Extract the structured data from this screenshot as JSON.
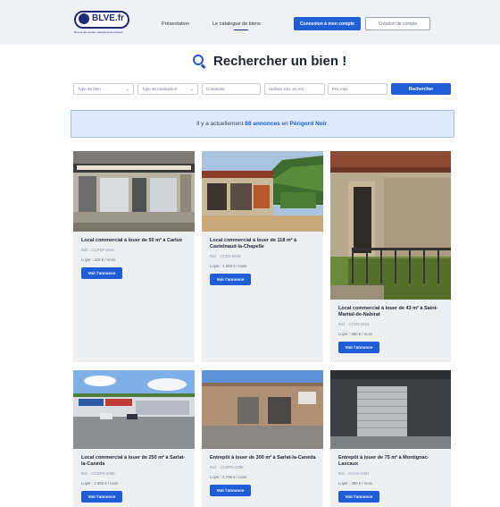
{
  "header": {
    "logo_text": "BLVE.fr",
    "logo_tagline": "Bourse des locaux vacants économiques",
    "nav": [
      "Présentation",
      "Le catalogue de biens"
    ],
    "login_label": "Connexion à mon compte",
    "create_label": "Création de compte"
  },
  "page_title": "Rechercher un bien !",
  "search": {
    "type_bien": "Type de bien",
    "type_transaction": "Type de transaction",
    "commune_placeholder": "Commune",
    "surface_placeholder": "Surface min. en m2",
    "prix_placeholder": "Prix max",
    "submit_label": "Rechercher"
  },
  "banner": {
    "prefix": "Il y a actuellement ",
    "count": "88 annonces",
    "middle": " en ",
    "region": "Périgord Noir",
    "suffix": "."
  },
  "listings": [
    {
      "title": "Local commercial à louer de 50 m² à Carlux",
      "ref": "Réf. : CCPSF-2433",
      "rent": "Loyer : 416 € / mois",
      "button": "Voir l'annonce"
    },
    {
      "title": "Local commercial à louer de 118 m² à Castelnaud-la-Chapelle",
      "ref": "Réf. : CCDV-2409",
      "rent": "Loyer : 1 000 € / mois",
      "button": "Voir l'annonce"
    },
    {
      "title": "Local commercial à louer de 43 m² à Saint-Martial-de-Nabirat",
      "ref": "Réf. : CCDV-2403",
      "rent": "Loyer : 380 € / mois",
      "button": "Voir l'annonce"
    },
    {
      "title": "Local commercial à louer de 250 m² à Sarlat-la-Canéda",
      "ref": "Réf. : CCSPN-2396",
      "rent": "Loyer : 2 690 € / mois",
      "button": "Voir l'annonce"
    },
    {
      "title": "Entrepôt à louer de 300 m² à Sarlat-la-Canéda",
      "ref": "Réf. : CCSPN-2395",
      "rent": "Loyer : 1 790 € / mois",
      "button": "Voir l'annonce"
    },
    {
      "title": "Entrepôt à louer de 75 m² à Montignac-Lascaux",
      "ref": "Réf. : CCVH-2391",
      "rent": "Loyer : 380 € / mois",
      "button": "Voir l'annonce"
    }
  ]
}
